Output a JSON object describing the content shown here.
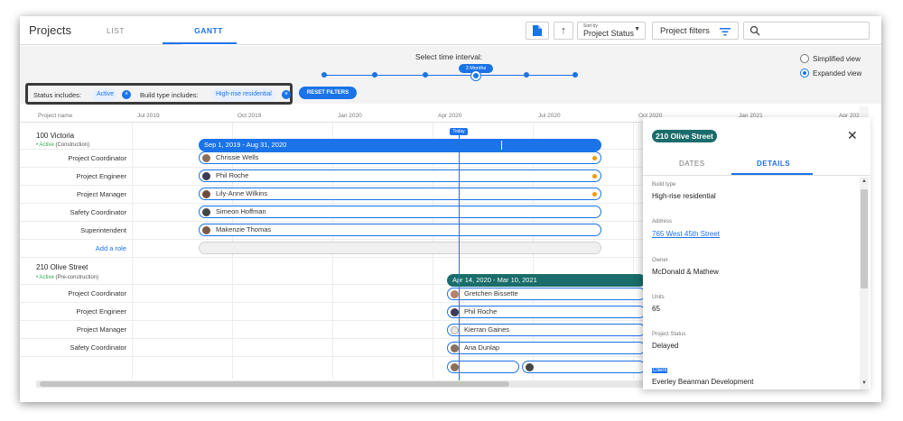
{
  "header": {
    "title": "Projects",
    "tabs": [
      "LIST",
      "GANTT"
    ],
    "sort_label": "Sort by",
    "sort_value": "Project Status",
    "filter_label": "Project filters"
  },
  "toolbar": {
    "interval_label": "Select time interval:",
    "interval_value": "3 Months",
    "view_simplified": "Simplified view",
    "view_expanded": "Expanded view",
    "filters": {
      "status_label": "Status includes:",
      "status_value": "Active",
      "build_label": "Build type includes:",
      "build_value": "High-rise residential",
      "reset_label": "RESET FILTERS"
    }
  },
  "gantt": {
    "column_header": "Project name",
    "months": [
      "Jul 2019",
      "Oct 2019",
      "Jan 2020",
      "Apr 2020",
      "Jul 2020",
      "Oct 2020",
      "Jan 2021",
      "Apr 2021"
    ],
    "today_label": "Today",
    "projects": [
      {
        "name": "100 Victoria",
        "status": "• Active",
        "phase": "(Construction)",
        "bar_label": "Sep 1, 2019 - Aug 31, 2020",
        "roles": [
          {
            "role": "Project Coordinator",
            "person": "Chrissie Wells"
          },
          {
            "role": "Project Engineer",
            "person": "Phil Roche"
          },
          {
            "role": "Project Manager",
            "person": "Lily-Anne Wilkins"
          },
          {
            "role": "Safety Coordinator",
            "person": "Simeon Hoffman"
          },
          {
            "role": "Superintendent",
            "person": "Makenzie Thomas"
          }
        ],
        "add_role": "Add a role"
      },
      {
        "name": "210 Olive Street",
        "status": "• Active",
        "phase": "(Pre-construction)",
        "bar_label": "Apr 14, 2020 - Mar 10, 2021",
        "roles": [
          {
            "role": "Project Coordinator",
            "person": "Gretchen Bissette"
          },
          {
            "role": "Project Engineer",
            "person": "Phil Roche"
          },
          {
            "role": "Project Manager",
            "person": "Kierran Gaines"
          },
          {
            "role": "Safety Coordinator",
            "person": "Ana Dunlap"
          }
        ]
      }
    ]
  },
  "panel": {
    "title": "210 Olive Street",
    "tabs": [
      "DATES",
      "DETAILS"
    ],
    "fields": [
      {
        "label": "Build type",
        "value": "High-rise residential"
      },
      {
        "label": "Address",
        "value": "765 West 45th Street"
      },
      {
        "label": "Owner",
        "value": "McDonald & Mathew"
      },
      {
        "label": "Units",
        "value": "65"
      },
      {
        "label": "Project Status",
        "value": "Delayed"
      },
      {
        "label": "Client",
        "value": "Everley Beanman Development"
      }
    ]
  },
  "colors": {
    "accent": "#1a73e8",
    "teal": "#1a6d6a",
    "warning": "#f29900"
  }
}
